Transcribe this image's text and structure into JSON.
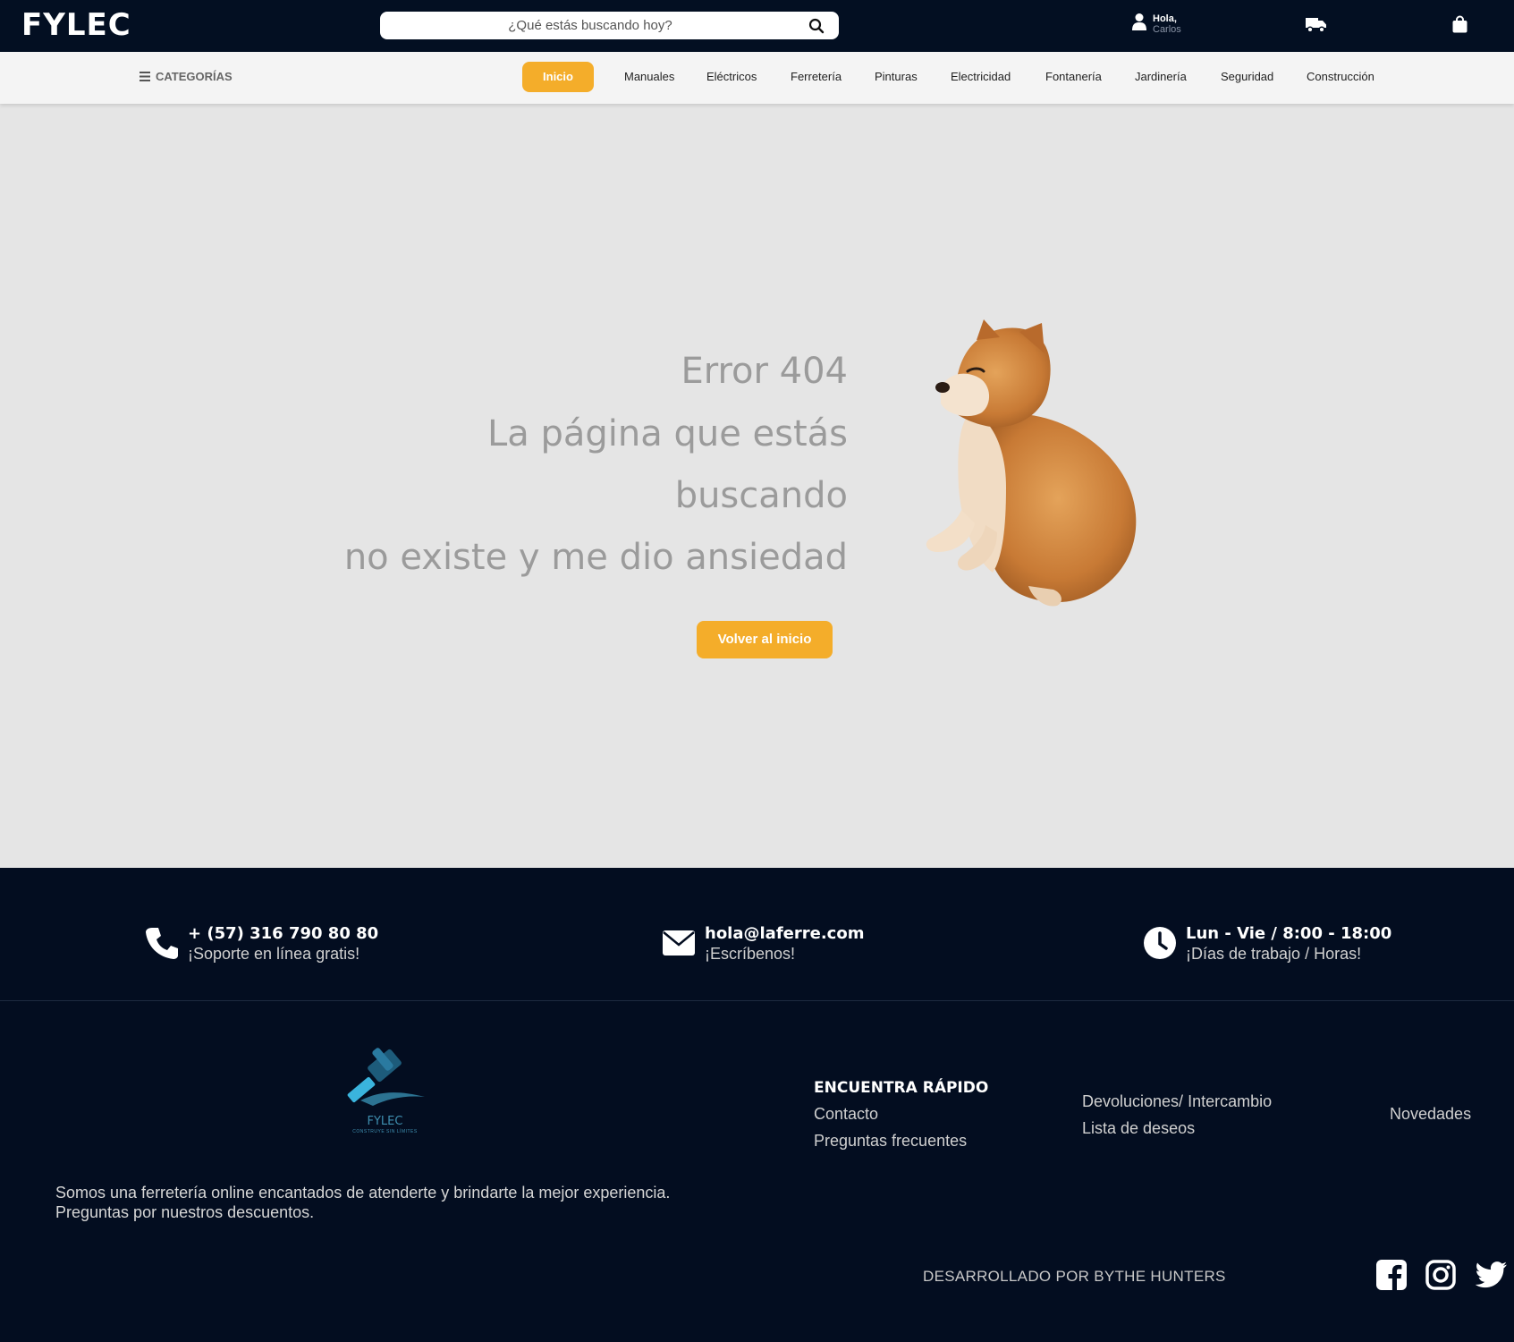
{
  "header": {
    "logo": "FYLEC",
    "search_placeholder": "¿Qué estás buscando hoy?",
    "greeting": "Hola,",
    "user_name": "Carlos"
  },
  "nav": {
    "categories_label": "CATEGORÍAS",
    "items": [
      "Inicio",
      "Manuales",
      "Eléctricos",
      "Ferretería",
      "Pinturas",
      "Electricidad",
      "Fontanería",
      "Jardinería",
      "Seguridad",
      "Construcción"
    ],
    "active_index": 0
  },
  "error": {
    "lines": [
      "Error 404",
      "La página que estás",
      "buscando",
      "no existe y me dio ansiedad"
    ],
    "button_label": "Volver al inicio"
  },
  "footer": {
    "contacts": [
      {
        "title": "+ (57) 316 790 80 80",
        "subtitle": "¡Soporte en línea gratis!",
        "icon": "phone-icon"
      },
      {
        "title": "hola@laferre.com",
        "subtitle": "¡Escríbenos!",
        "icon": "envelope-icon"
      },
      {
        "title": "Lun - Vie / 8:00 - 18:00",
        "subtitle": "¡Días de trabajo / Horas!",
        "icon": "clock-icon"
      }
    ],
    "logo_text": "FYLEC",
    "logo_tagline": "CONSTRUYE SIN LÍMITES",
    "about_line1": "Somos una ferretería online encantados de atenderte y brindarte la mejor experiencia.",
    "about_line2": "Preguntas por nuestros descuentos.",
    "quick_heading": "ENCUENTRA RÁPIDO",
    "links": {
      "contacto": "Contacto",
      "preguntas": "Preguntas frecuentes",
      "devoluciones": "Devoluciones/ Intercambio",
      "deseos": "Lista de deseos",
      "novedades": "Novedades"
    },
    "developed_by": "DESARROLLADO POR BYTHE HUNTERS",
    "social": [
      "facebook-icon",
      "instagram-icon",
      "twitter-icon"
    ]
  },
  "colors": {
    "header_bg": "#030f22",
    "accent": "#f4ad2a",
    "page_bg": "#e5e5e5",
    "footer_bg": "#030d20"
  }
}
